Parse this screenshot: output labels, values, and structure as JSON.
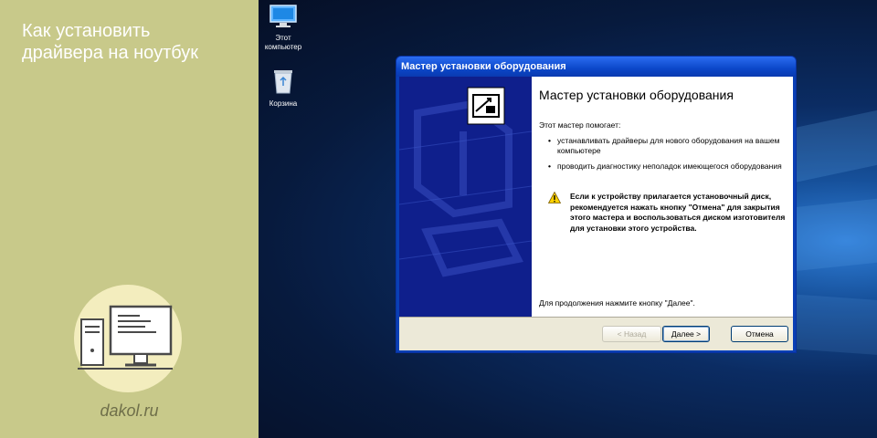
{
  "banner": {
    "title_line1": "Как установить",
    "title_line2": "драйвера на ноутбук",
    "site": "dakol.ru"
  },
  "desktop": {
    "icons": [
      {
        "label_line1": "Этот",
        "label_line2": "компьютер",
        "icon": "computer-icon"
      },
      {
        "label_line1": "Корзина",
        "label_line2": "",
        "icon": "recycle-bin-icon"
      }
    ]
  },
  "wizard": {
    "title": "Мастер установки оборудования",
    "heading": "Мастер установки оборудования",
    "intro": "Этот мастер помогает:",
    "bullets": [
      "устанавливать драйверы для нового оборудования на вашем компьютере",
      "проводить диагностику неполадок имеющегося оборудования"
    ],
    "warning": "Если к устройству прилагается установочный диск, рекомендуется нажать кнопку \"Отмена\" для закрытия этого мастера и воспользоваться диском изготовителя для установки этого устройства.",
    "footer": "Для продолжения нажмите кнопку \"Далее\".",
    "buttons": {
      "back": "< Назад",
      "next": "Далее >",
      "cancel": "Отмена"
    }
  },
  "colors": {
    "banner_bg": "#c8c98a",
    "xp_title_blue": "#0b47c9",
    "wizard_sidebar": "#0f1f8c",
    "desktop_bg": "#0b2c63"
  }
}
